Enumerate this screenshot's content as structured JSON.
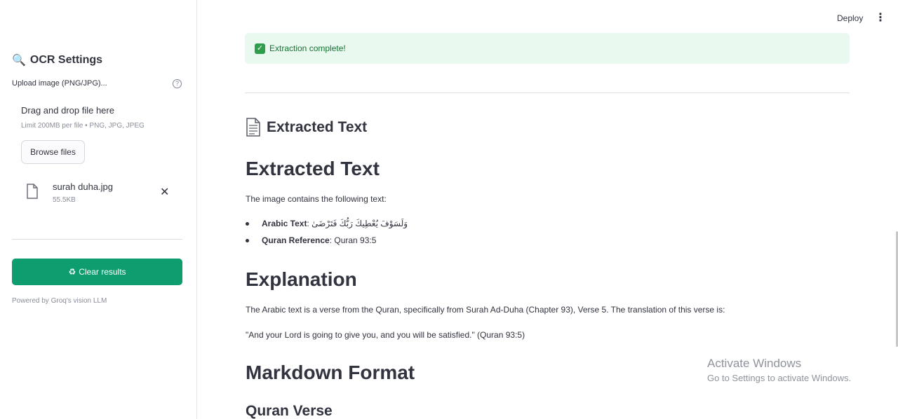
{
  "sidebar": {
    "title": "OCR Settings",
    "upload_label": "Upload image (PNG/JPG)...",
    "help_icon": "?",
    "dropzone_text": "Drag and drop file here",
    "dropzone_limit": "Limit 200MB per file • PNG, JPG, JPEG",
    "browse_label": "Browse files",
    "file": {
      "name": "surah duha.jpg",
      "size": "55.5KB"
    },
    "close_glyph": "✕",
    "clear_label": "Clear results",
    "powered_by": "Powered by Groq's vision LLM"
  },
  "header": {
    "deploy_label": "Deploy",
    "menu_glyph": "⋮"
  },
  "main": {
    "success_text": "Extraction complete!",
    "section_title": "Extracted Text",
    "h1_extracted": "Extracted Text",
    "intro": "The image contains the following text:",
    "bullets": [
      {
        "label": "Arabic Text",
        "value": ": وَلَسَوْفَ يُعْطِيكَ رَبُّكَ فَتَرْضَىٰ"
      },
      {
        "label": "Quran Reference",
        "value": ": Quran 93:5"
      }
    ],
    "h1_explanation": "Explanation",
    "explanation_p1": "The Arabic text is a verse from the Quran, specifically from Surah Ad-Duha (Chapter 93), Verse 5. The translation of this verse is:",
    "explanation_p2": "\"And your Lord is going to give you, and you will be satisfied.\" (Quran 93:5)",
    "h1_markdown": "Markdown Format",
    "h3_verse": "Quran Verse"
  },
  "watermark": {
    "line1": "Activate Windows",
    "line2": "Go to Settings to activate Windows."
  },
  "colors": {
    "primary": "#0e9d6e",
    "success_bg": "#e9f9ef",
    "success_text": "#177233",
    "text": "#31333f"
  }
}
